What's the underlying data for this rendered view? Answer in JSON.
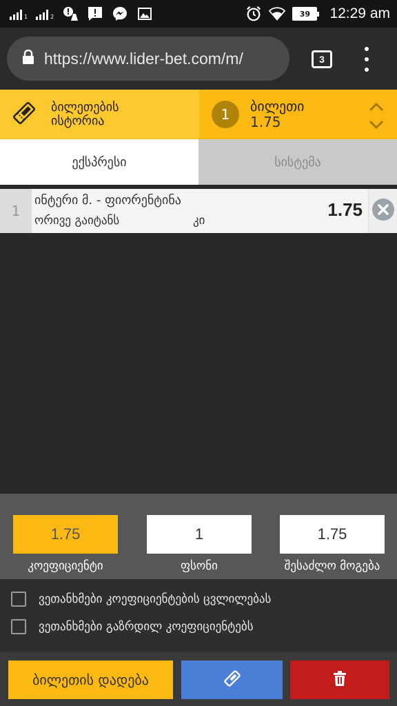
{
  "status_bar": {
    "time": "12:29 am",
    "battery": "39",
    "icons": [
      "signal-sim1-icon",
      "signal-sim2-icon",
      "notification-alert-icon",
      "cleaner-icon",
      "message-alert-icon",
      "messenger-icon",
      "gallery-icon",
      "alarm-icon",
      "wifi-icon",
      "battery-icon"
    ]
  },
  "browser": {
    "url": "https://www.lider-bet.com/m/",
    "tab_count": "3",
    "icons": [
      "lock-icon",
      "tabs-icon",
      "overflow-menu-icon"
    ]
  },
  "header": {
    "history_label": "ბილეთების ისტორია",
    "slip_count": "1",
    "slip_title": "ბილეთი",
    "slip_odds": "1.75",
    "colors": {
      "history_bg": "#fec82f",
      "slip_bg": "#fdb913"
    }
  },
  "tabs": [
    {
      "label": "ექსპრესი",
      "active": true
    },
    {
      "label": "სისტემა",
      "active": false
    }
  ],
  "bets": [
    {
      "number": "1",
      "match": "ინტერი მ. - ფიორენტინა",
      "market": "ორივე გაიტანს",
      "pick": "კი",
      "odds": "1.75"
    }
  ],
  "summary": {
    "coefficient": {
      "value": "1.75",
      "label": "კოეფიციენტი"
    },
    "stake": {
      "value": "1",
      "label": "ფსონი"
    },
    "possible_win": {
      "value": "1.75",
      "label": "შესაძლო მოგება"
    }
  },
  "options": [
    {
      "label": "ვეთანხმები კოეფიციენტების ცვლილებას",
      "checked": false
    },
    {
      "label": "ვეთანხმები გაზრდილ კოეფიციენტებს",
      "checked": false
    }
  ],
  "actions": {
    "place_label": "ბილეთის დადება",
    "colors": {
      "place": "#fdb913",
      "share": "#4a7fd8",
      "delete": "#c41b1b"
    }
  }
}
